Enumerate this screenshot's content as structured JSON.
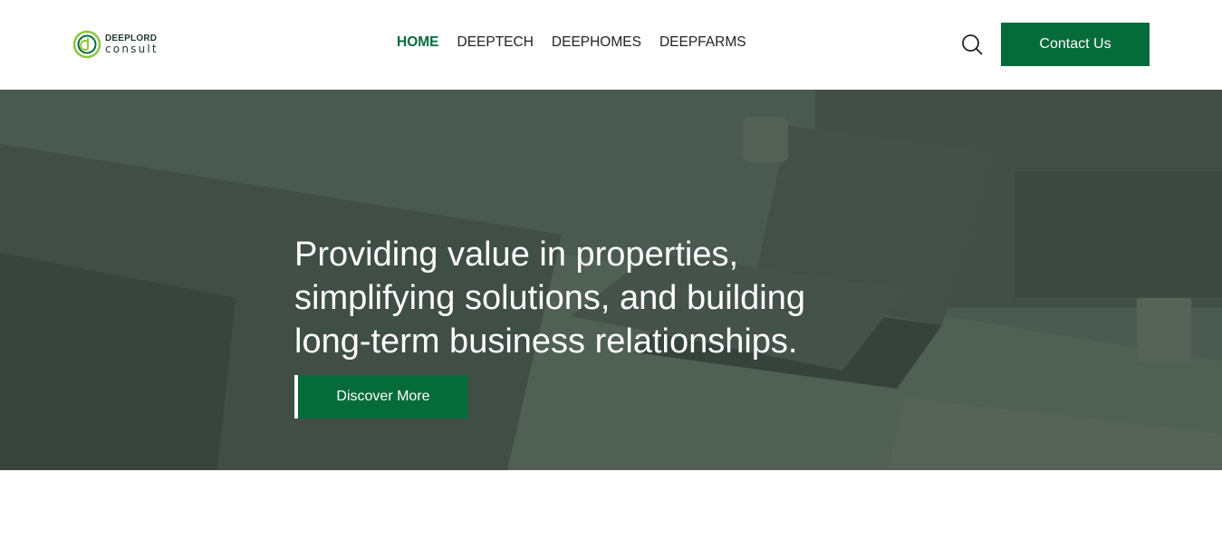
{
  "header": {
    "logo": {
      "name": "DEEPLORD",
      "subtitle": "consult",
      "icon": "deeplord-logo-mark"
    },
    "nav": [
      {
        "label": "HOME",
        "active": true
      },
      {
        "label": "DEEPTECH",
        "active": false
      },
      {
        "label": "DEEPHOMES",
        "active": false
      },
      {
        "label": "DEEPFARMS",
        "active": false
      }
    ],
    "search_icon": "search-icon",
    "contact_label": "Contact Us"
  },
  "hero": {
    "headline_lines": [
      "Providing value in properties,",
      "simplifying solutions, and building",
      "long-term business relationships."
    ],
    "cta_label": "Discover More"
  },
  "colors": {
    "brand_green": "#056b3a",
    "hero_tint": "#5b655d",
    "text_dark": "#222222",
    "white": "#ffffff"
  }
}
